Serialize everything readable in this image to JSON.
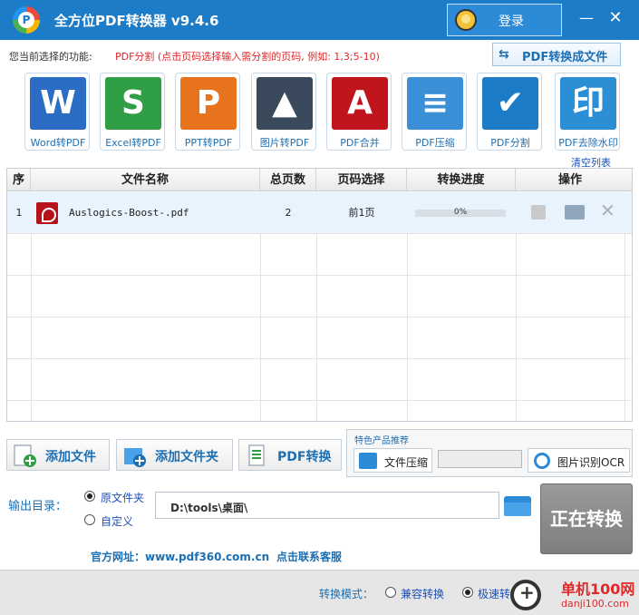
{
  "app": {
    "title": "全方位PDF转换器 v9.4.6",
    "logo_letter": "P"
  },
  "header": {
    "login_label": "登录",
    "minimize_glyph": "—",
    "close_glyph": "✕"
  },
  "func": {
    "label": "您当前选择的功能:",
    "description": "PDF分割 (点击页码选择输入需分割的页码, 例如: 1,3;5-10)",
    "convert_button": "PDF转换成文件",
    "convert_icon": "⇆"
  },
  "tools": [
    {
      "label": "Word转PDF",
      "glyph": "W",
      "color": "#2b6cc4"
    },
    {
      "label": "Excel转PDF",
      "glyph": "S",
      "color": "#2f9e44"
    },
    {
      "label": "PPT转PDF",
      "glyph": "P",
      "color": "#e8731e"
    },
    {
      "label": "图片转PDF",
      "glyph": "▲",
      "color": "#3a4a5c"
    },
    {
      "label": "PDF合并",
      "glyph": "A",
      "color": "#c0151d"
    },
    {
      "label": "PDF压缩",
      "glyph": "≡",
      "color": "#3b8fd6"
    },
    {
      "label": "PDF分割",
      "glyph": "✔",
      "color": "#1d7cc8"
    },
    {
      "label": "PDF去除水印",
      "glyph": "印",
      "color": "#2b8fd6"
    }
  ],
  "clear_list": "清空列表",
  "table": {
    "headers": [
      "序",
      "文件名称",
      "总页数",
      "页码选择",
      "转换进度",
      "操作"
    ],
    "rows": [
      {
        "index": "1",
        "name": "Auslogics-Boost-.pdf",
        "pages": "2",
        "page_select": "前1页",
        "progress": 0,
        "progress_text": "0%"
      }
    ]
  },
  "actions": {
    "add_file": "添加文件",
    "add_folder": "添加文件夹",
    "pdf_convert": "PDF转换"
  },
  "promo": {
    "title": "特色产品推荐",
    "compress": "文件压缩",
    "ocr": "图片识别OCR"
  },
  "output": {
    "label": "输出目录：",
    "option_original": "原文件夹",
    "option_custom": "自定义",
    "path": "D:\\tools\\桌面\\",
    "start_button": "正在转换"
  },
  "links": {
    "site": "官方网址：www.pdf360.com.cn",
    "contact": "点击联系客服"
  },
  "footer": {
    "mode_label": "转换模式：",
    "compat": "兼容转换",
    "fast": "极速转换",
    "watermark_line1": "单机100网",
    "watermark_line2": "danji100.com"
  }
}
